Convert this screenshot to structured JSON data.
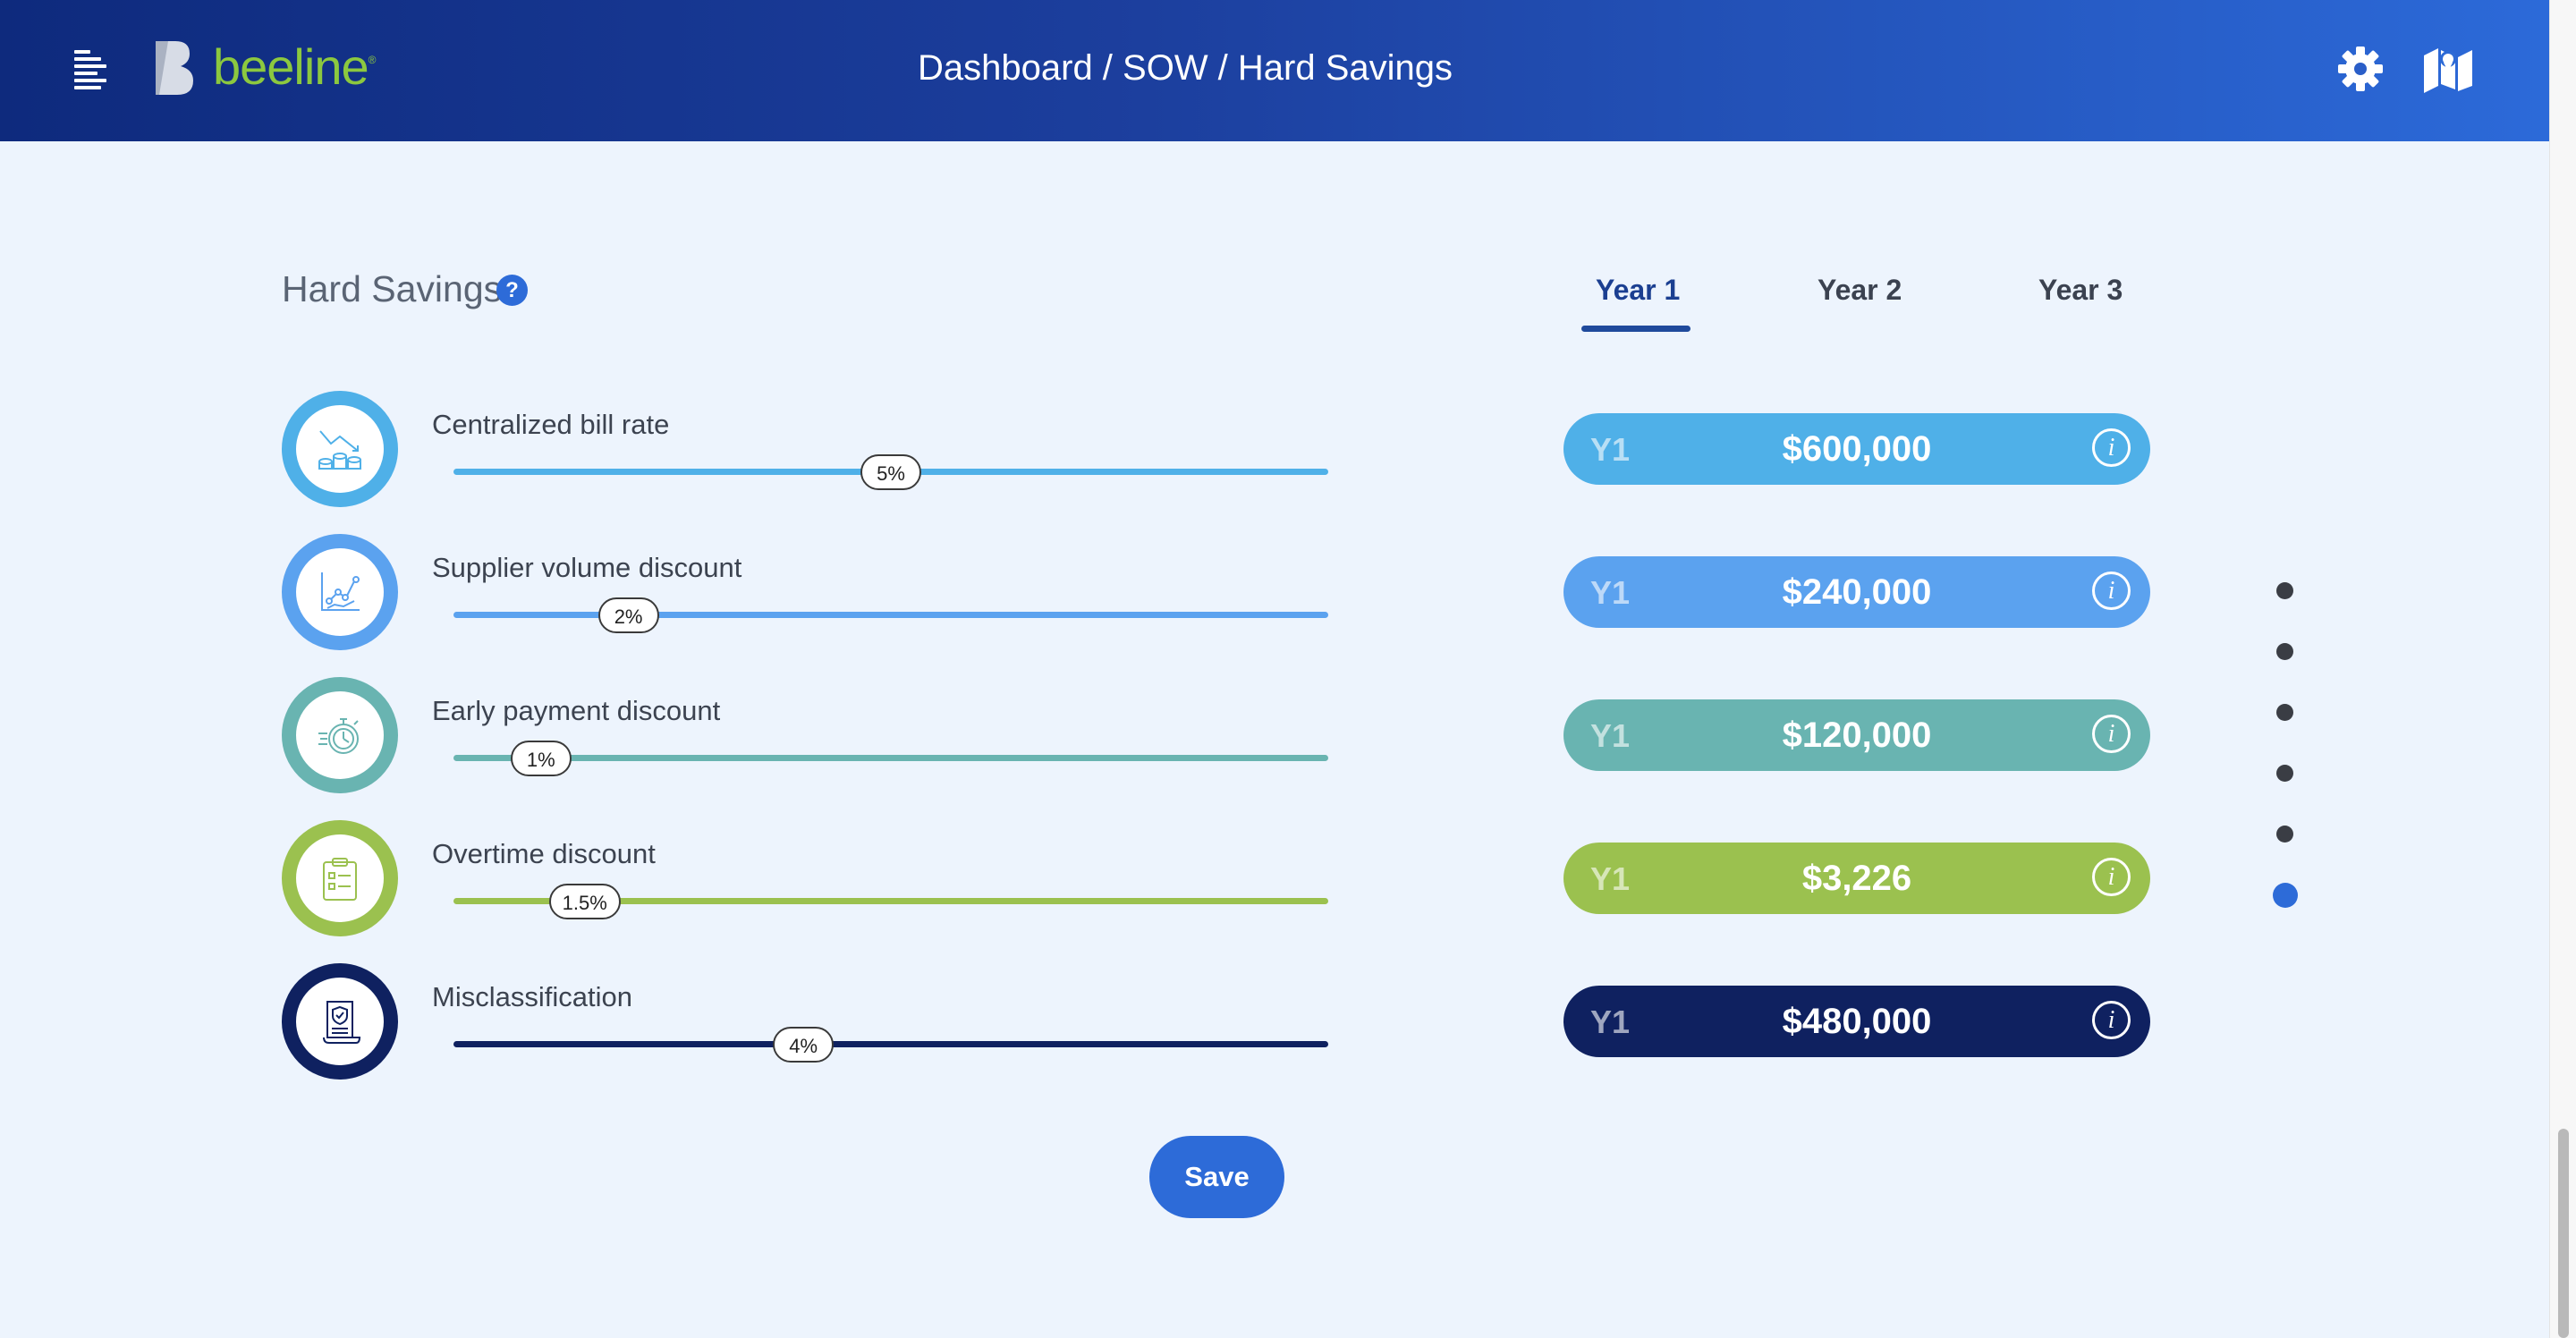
{
  "header": {
    "logo_text": "beeline",
    "logo_mark": "®",
    "breadcrumb": "Dashboard / SOW / Hard Savings",
    "icons": [
      "menu-icon",
      "gear-icon",
      "map-icon"
    ]
  },
  "section": {
    "title": "Hard Savings",
    "help_symbol": "?"
  },
  "tabs": [
    {
      "label": "Year 1",
      "active": true
    },
    {
      "label": "Year 2",
      "active": false
    },
    {
      "label": "Year 3",
      "active": false
    }
  ],
  "rows": [
    {
      "label": "Centralized bill rate",
      "slider_value": "5%",
      "slider_fraction": 0.5,
      "pill_year": "Y1",
      "amount": "$600,000",
      "icon": "coins-trend-icon",
      "color": "#4fb0e8",
      "color_light": "#a6d8f4"
    },
    {
      "label": "Supplier volume discount",
      "slider_value": "2%",
      "slider_fraction": 0.2,
      "pill_year": "Y1",
      "amount": "$240,000",
      "icon": "line-chart-icon",
      "color": "#5ba2ef",
      "color_light": "#a9cdf6"
    },
    {
      "label": "Early payment discount",
      "slider_value": "1%",
      "slider_fraction": 0.1,
      "pill_year": "Y1",
      "amount": "$120,000",
      "icon": "stopwatch-icon",
      "color": "#69b4b1",
      "color_light": "#b0d8d6"
    },
    {
      "label": "Overtime discount",
      "slider_value": "1.5%",
      "slider_fraction": 0.15,
      "pill_year": "Y1",
      "amount": "$3,226",
      "icon": "clipboard-icon",
      "color": "#9bc14f",
      "color_light": "#cbe0a3"
    },
    {
      "label": "Misclassification",
      "slider_value": "4%",
      "slider_fraction": 0.4,
      "pill_year": "Y1",
      "amount": "$480,000",
      "icon": "contract-shield-icon",
      "color": "#0f2160",
      "color_light": "#8a94b6"
    }
  ],
  "pagination": {
    "count": 6,
    "active_index": 5
  },
  "save_label": "Save",
  "info_symbol": "i"
}
